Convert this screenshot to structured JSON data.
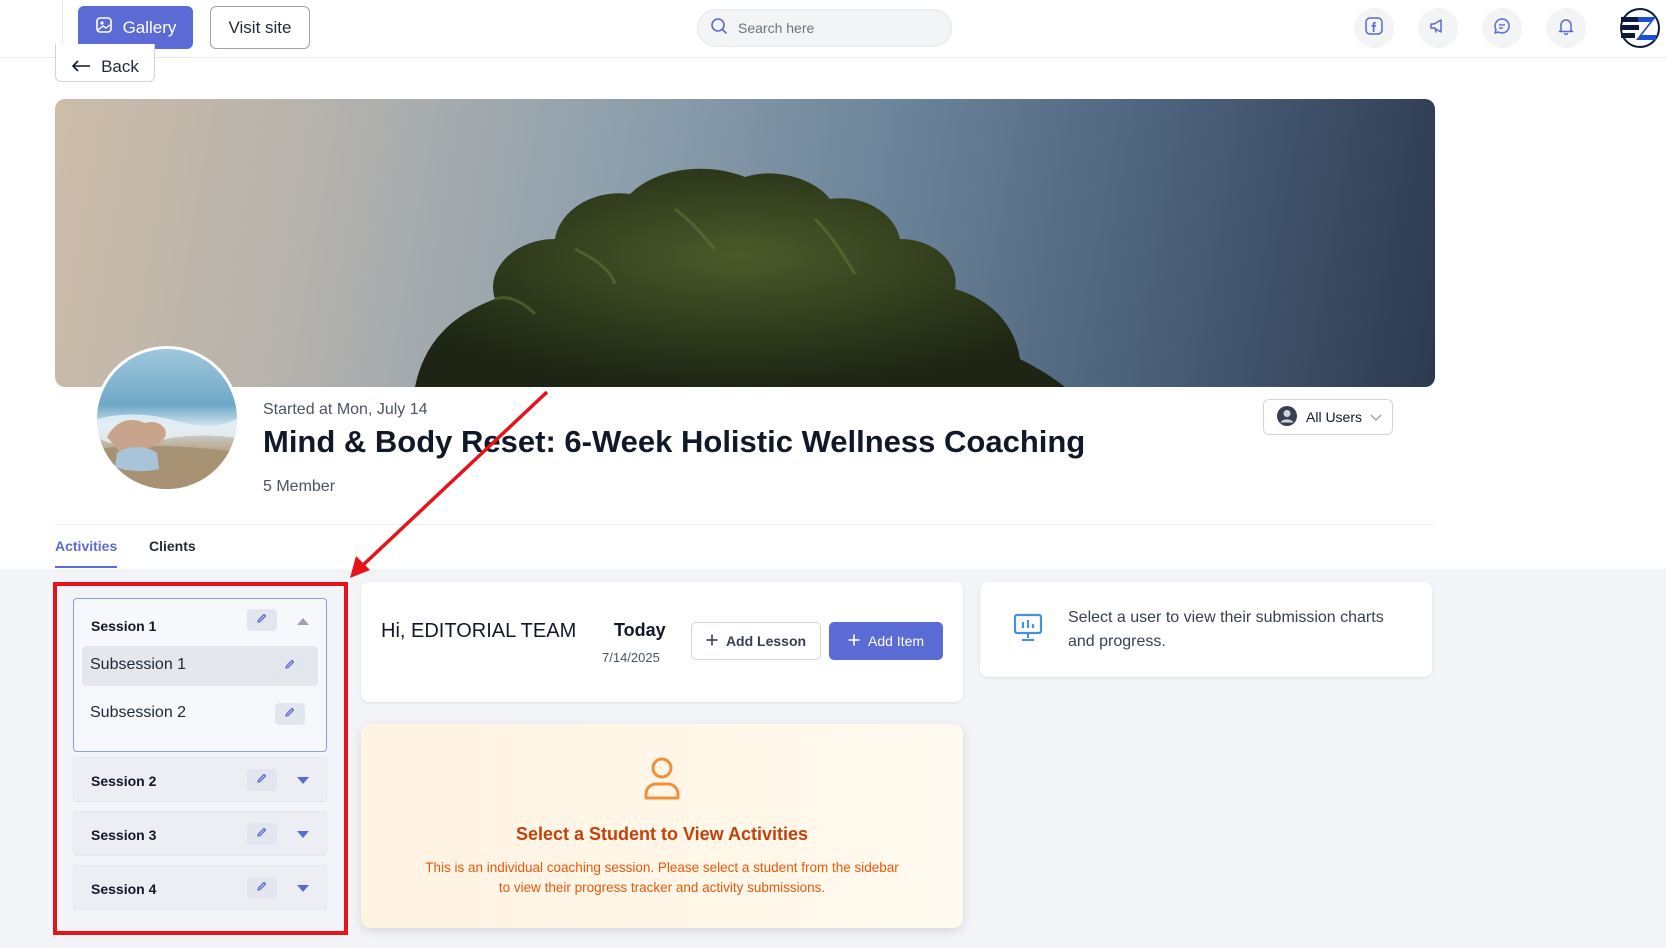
{
  "header": {
    "gallery_label": "Gallery",
    "visit_site_label": "Visit site",
    "search_placeholder": "Search here",
    "icons": [
      "facebook-icon",
      "megaphone-icon",
      "chat-icon",
      "bell-icon"
    ]
  },
  "back_label": "Back",
  "course": {
    "started": "Started at Mon, July 14",
    "title": "Mind & Body Reset: 6-Week Holistic Wellness Coaching",
    "members": "5 Member",
    "user_filter": "All Users"
  },
  "tabs": [
    {
      "label": "Activities",
      "active": true
    },
    {
      "label": "Clients",
      "active": false
    }
  ],
  "sessions": [
    {
      "label": "Session 1",
      "expanded": true,
      "subsessions": [
        {
          "label": "Subsession 1",
          "active": true
        },
        {
          "label": "Subsession 2",
          "active": false
        }
      ]
    },
    {
      "label": "Session 2",
      "expanded": false
    },
    {
      "label": "Session 3",
      "expanded": false
    },
    {
      "label": "Session 4",
      "expanded": false
    }
  ],
  "greeting": {
    "text": "Hi, EDITORIAL TEAM",
    "today_label": "Today",
    "date": "7/14/2025",
    "add_lesson_label": "Add Lesson",
    "add_item_label": "Add Item"
  },
  "student_prompt": {
    "title": "Select a Student to View Activities",
    "line1": "This is an individual coaching session. Please select a student from the sidebar",
    "line2": "to view their progress tracker and activity submissions."
  },
  "info": {
    "text": "Select a user to view their submission charts and progress."
  },
  "colors": {
    "accent": "#5b6bd6",
    "annotation_red": "#e6131a",
    "prompt_title": "#c2410c",
    "prompt_text": "#ea580c"
  }
}
